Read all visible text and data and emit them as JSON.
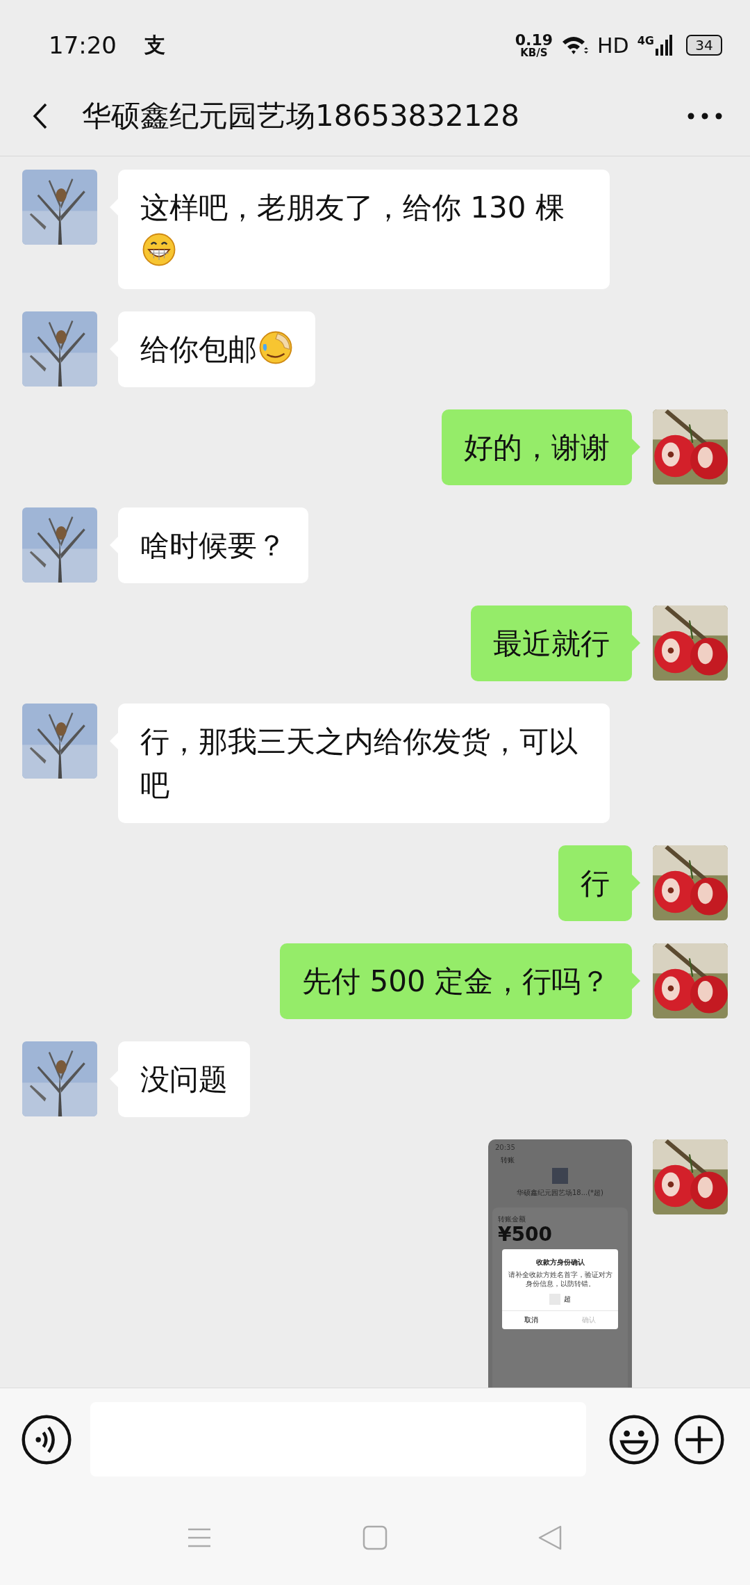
{
  "status_bar": {
    "time": "17:20",
    "app_icon": "支",
    "speed": "0.19",
    "speed_unit": "KB/S",
    "network": "HD",
    "network_type": "4G",
    "battery": "34"
  },
  "header": {
    "title": "华硕鑫纪元园艺场18653832128"
  },
  "messages": [
    {
      "outgoing": false,
      "kind": "text",
      "text": "这样吧，老朋友了，给你 130 棵",
      "emoji": {
        "kind": "grin"
      }
    },
    {
      "outgoing": false,
      "kind": "text",
      "text": "给你包邮",
      "emoji": {
        "kind": "facepalm"
      }
    },
    {
      "outgoing": true,
      "kind": "text",
      "text": "好的，谢谢"
    },
    {
      "outgoing": false,
      "kind": "text",
      "text": "啥时候要？"
    },
    {
      "outgoing": true,
      "kind": "text",
      "text": "最近就行"
    },
    {
      "outgoing": false,
      "kind": "text",
      "text": "行，那我三天之内给你发货，可以吧"
    },
    {
      "outgoing": true,
      "kind": "text",
      "text": "行"
    },
    {
      "outgoing": true,
      "kind": "text",
      "text": "先付 500 定金，行吗？"
    },
    {
      "outgoing": false,
      "kind": "text",
      "text": "没问题"
    },
    {
      "outgoing": true,
      "kind": "screenshot",
      "screenshot": {
        "time": "20:35",
        "title": "转账",
        "payee": "华硕鑫纪元园艺场18...(*超)",
        "amount_label": "转账金额",
        "amount": "¥500",
        "dialog": {
          "title": "收款方身份确认",
          "message": "请补全收款方姓名首字，验证对方身份信息，以防转错。",
          "name_rest": "超",
          "cancel": "取消",
          "confirm": "确认",
          "confirm_disabled": true
        }
      }
    }
  ]
}
